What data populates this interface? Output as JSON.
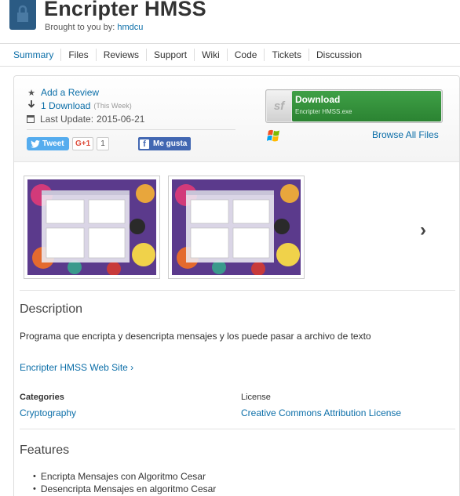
{
  "header": {
    "title": "Encripter HMSS",
    "byline_prefix": "Brought to you by:",
    "author": "hmdcu"
  },
  "tabs": [
    {
      "label": "Summary",
      "active": true
    },
    {
      "label": "Files"
    },
    {
      "label": "Reviews"
    },
    {
      "label": "Support"
    },
    {
      "label": "Wiki"
    },
    {
      "label": "Code"
    },
    {
      "label": "Tickets"
    },
    {
      "label": "Discussion"
    }
  ],
  "stats": {
    "review_label": "Add a Review",
    "downloads_label": "1 Download",
    "downloads_period": "(This Week)",
    "last_update_label": "Last Update:",
    "last_update_date": "2015-06-21"
  },
  "social": {
    "tweet": "Tweet",
    "gplus": "G+1",
    "gplus_count": "1",
    "facebook": "Me gusta"
  },
  "download": {
    "sf_badge": "sf",
    "button_label": "Download",
    "file_name": "Encripter HMSS.exe",
    "browse_label": "Browse All Files"
  },
  "screenshots": {
    "next_symbol": "›"
  },
  "description": {
    "heading": "Description",
    "text": "Programa que encripta y desencripta mensajes y los puede pasar a archivo de texto",
    "website_label": "Encripter HMSS Web Site ›"
  },
  "meta": {
    "categories_heading": "Categories",
    "category": "Cryptography",
    "license_heading": "License",
    "license": "Creative Commons Attribution License"
  },
  "features": {
    "heading": "Features",
    "items": [
      "Encripta Mensajes con Algoritmo Cesar",
      "Desencripta Mensajes en algoritmo Cesar"
    ]
  },
  "colors": {
    "link": "#0b6ea8",
    "download_green": "#3fa046",
    "tweet_blue": "#55acee",
    "facebook_blue": "#4267b2",
    "logo_blue": "#2b5b84"
  }
}
